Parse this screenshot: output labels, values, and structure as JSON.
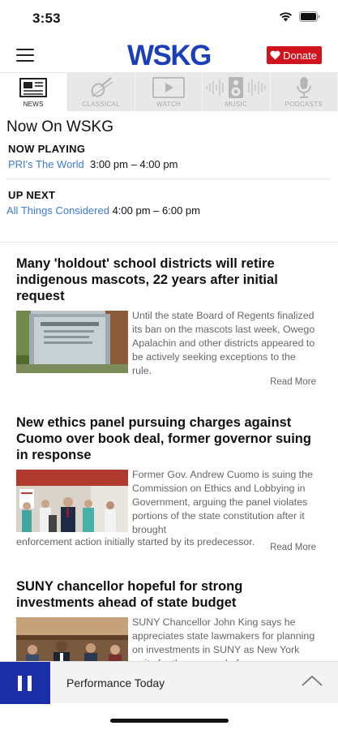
{
  "status_bar": {
    "time": "3:53"
  },
  "header": {
    "logo": "WSKG",
    "donate_label": "Donate"
  },
  "tabs": [
    {
      "label": "NEWS",
      "icon": "newspaper-icon",
      "active": true
    },
    {
      "label": "CLASSICAL",
      "icon": "violin-icon",
      "active": false
    },
    {
      "label": "WATCH",
      "icon": "play-screen-icon",
      "active": false
    },
    {
      "label": "MUSIC",
      "icon": "speaker-icon",
      "active": false
    },
    {
      "label": "PODCASTS",
      "icon": "microphone-icon",
      "active": false
    }
  ],
  "now_on": {
    "title": "Now On WSKG",
    "now_playing": {
      "label": "NOW PLAYING",
      "show": "PRI's The World",
      "time": "3:00 pm – 4:00 pm"
    },
    "up_next": {
      "label": "UP NEXT",
      "show": "All Things Considered",
      "time": "4:00 pm – 6:00 pm"
    }
  },
  "articles": [
    {
      "title": "Many 'holdout' school districts will retire indigenous mascots, 22 years after initial request",
      "summary": "Until the state Board of Regents finalized its ban on the mascots last week, Owego Apalachin and other districts appeared to be actively seeking exceptions to the rule.",
      "summary_tail": "",
      "read_more": "Read More"
    },
    {
      "title": "New ethics panel pursuing charges against Cuomo over book deal, former governor suing in response",
      "summary": "Former Gov. Andrew Cuomo is suing the Commission on Ethics and Lobbying in Government, arguing the panel violates portions of the state constitution after it brought",
      "summary_tail": "enforcement action initially started by its predecessor.",
      "read_more": "Read More"
    },
    {
      "title": "SUNY chancellor hopeful for strong investments ahead of state budget",
      "summary": "SUNY Chancellor John King says he appreciates state lawmakers for planning on investments in SUNY as New York waits for the approval of",
      "summary_tail": "",
      "read_more": ""
    }
  ],
  "player": {
    "title": "Performance Today"
  },
  "colors": {
    "brand_blue": "#1b3fb8",
    "donate_red": "#d0141e",
    "link_blue": "#3a7bd5",
    "player_blue": "#1a2fa8"
  }
}
